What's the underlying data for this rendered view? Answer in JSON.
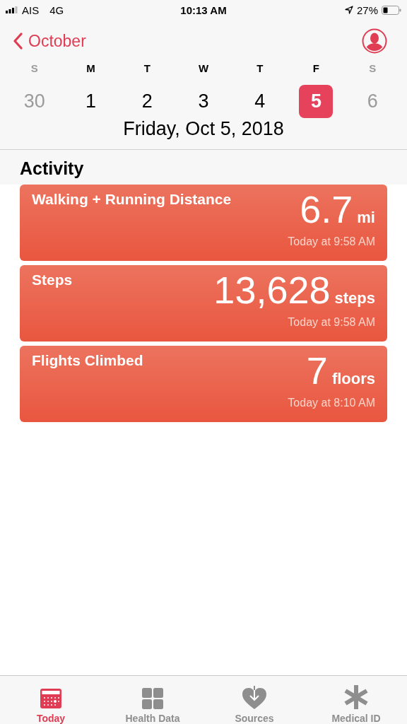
{
  "status_bar": {
    "carrier": "AIS",
    "network": "4G",
    "time": "10:13 AM",
    "battery": "27%"
  },
  "nav": {
    "back": "October"
  },
  "week": [
    {
      "weekday": "S",
      "day": "30",
      "in_month": false,
      "selected": false
    },
    {
      "weekday": "M",
      "day": "1",
      "in_month": true,
      "selected": false
    },
    {
      "weekday": "T",
      "day": "2",
      "in_month": true,
      "selected": false
    },
    {
      "weekday": "W",
      "day": "3",
      "in_month": true,
      "selected": false
    },
    {
      "weekday": "T",
      "day": "4",
      "in_month": true,
      "selected": false
    },
    {
      "weekday": "F",
      "day": "5",
      "in_month": true,
      "selected": true
    },
    {
      "weekday": "S",
      "day": "6",
      "in_month": false,
      "selected": false
    }
  ],
  "date_title": "Friday, Oct 5, 2018",
  "section": {
    "title": "Activity",
    "cards": [
      {
        "title": "Walking + Running Distance",
        "value": "6.7",
        "unit": "mi",
        "time": "Today at 9:58 AM"
      },
      {
        "title": "Steps",
        "value": "13,628",
        "unit": "steps",
        "time": "Today at 9:58 AM"
      },
      {
        "title": "Flights Climbed",
        "value": "7",
        "unit": "floors",
        "time": "Today at 8:10 AM"
      }
    ]
  },
  "tabs": [
    {
      "kind": "today",
      "label": "Today",
      "selected": true
    },
    {
      "kind": "data",
      "label": "Health Data",
      "selected": false
    },
    {
      "kind": "sources",
      "label": "Sources",
      "selected": false
    },
    {
      "kind": "medical",
      "label": "Medical ID",
      "selected": false
    }
  ]
}
